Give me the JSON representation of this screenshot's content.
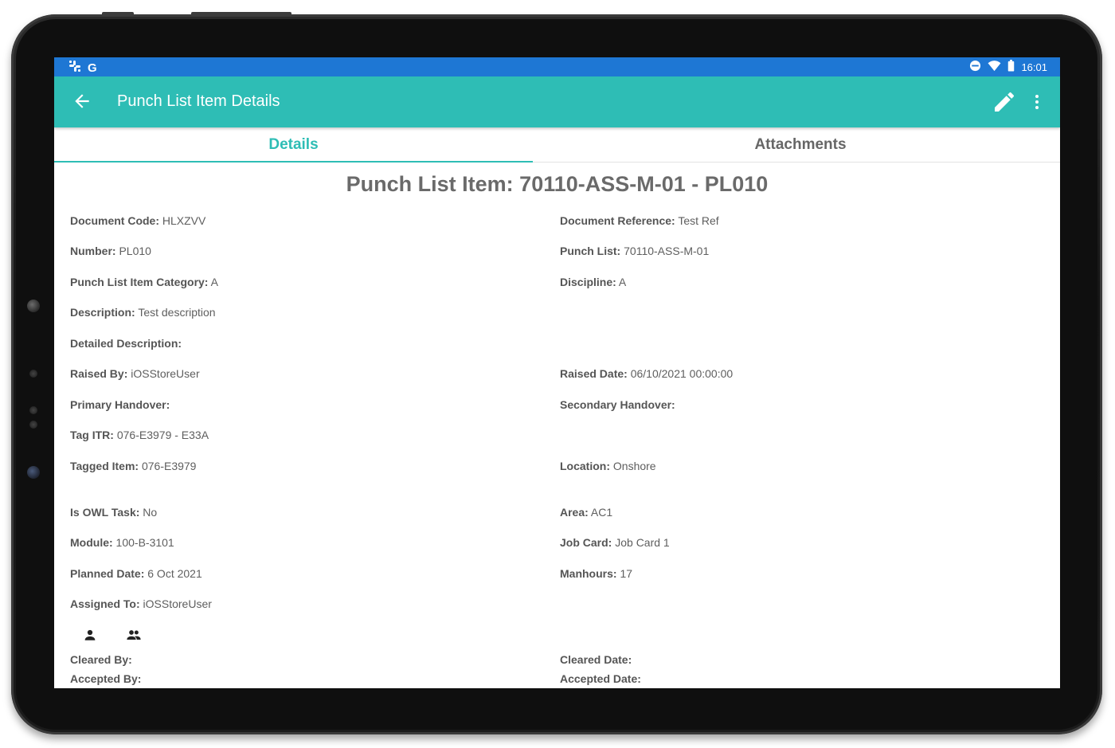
{
  "statusbar": {
    "left_icons": [
      "slack-icon",
      "google-icon"
    ],
    "right_icons": [
      "do-not-disturb-icon",
      "wifi-icon",
      "battery-icon"
    ],
    "time": "16:01"
  },
  "appbar": {
    "title": "Punch List Item Details",
    "back_icon": "arrow-left-icon",
    "edit_icon": "pencil-icon",
    "more_icon": "more-vert-icon"
  },
  "tabs": [
    {
      "label": "Details",
      "active": true
    },
    {
      "label": "Attachments",
      "active": false
    }
  ],
  "heading": "Punch List Item: 70110-ASS-M-01 - PL010",
  "fields": {
    "document_code": {
      "label": "Document Code:",
      "value": " HLXZVV"
    },
    "document_reference": {
      "label": "Document Reference:",
      "value": " Test Ref"
    },
    "number": {
      "label": "Number:",
      "value": " PL010"
    },
    "punch_list": {
      "label": "Punch List:",
      "value": " 70110-ASS-M-01"
    },
    "category": {
      "label": "Punch List Item Category:",
      "value": " A"
    },
    "discipline": {
      "label": "Discipline:",
      "value": " A"
    },
    "description": {
      "label": "Description:",
      "value": " Test description"
    },
    "detailed_description": {
      "label": "Detailed Description:",
      "value": ""
    },
    "raised_by": {
      "label": "Raised By:",
      "value": " iOSStoreUser"
    },
    "raised_date": {
      "label": "Raised Date:",
      "value": " 06/10/2021 00:00:00"
    },
    "primary_handover": {
      "label": "Primary Handover:",
      "value": ""
    },
    "secondary_handover": {
      "label": "Secondary Handover:",
      "value": ""
    },
    "tag_itr": {
      "label": "Tag ITR:",
      "value": " 076-E3979 - E33A"
    },
    "tagged_item": {
      "label": "Tagged Item:",
      "value": " 076-E3979"
    },
    "location": {
      "label": "Location:",
      "value": " Onshore"
    },
    "is_owl_task": {
      "label": "Is OWL Task:",
      "value": " No"
    },
    "area": {
      "label": "Area:",
      "value": " AC1"
    },
    "module": {
      "label": "Module:",
      "value": " 100-B-3101"
    },
    "job_card": {
      "label": "Job Card:",
      "value": " Job Card 1"
    },
    "planned_date": {
      "label": "Planned Date:",
      "value": " 6 Oct 2021"
    },
    "manhours": {
      "label": "Manhours:",
      "value": " 17"
    },
    "assigned_to": {
      "label": "Assigned To:",
      "value": " iOSStoreUser"
    },
    "cleared_by": {
      "label": "Cleared By:",
      "value": ""
    },
    "cleared_date": {
      "label": "Cleared Date:",
      "value": ""
    },
    "accepted_by": {
      "label": "Accepted By:",
      "value": ""
    },
    "accepted_date": {
      "label": "Accepted Date:",
      "value": ""
    }
  },
  "assign_icons": [
    "person-icon",
    "group-icon"
  ],
  "colors": {
    "statusbar": "#1e77d4",
    "appbar": "#2ebdb5",
    "accent": "#2ebdb5",
    "heading_text": "#6a6a6a"
  }
}
